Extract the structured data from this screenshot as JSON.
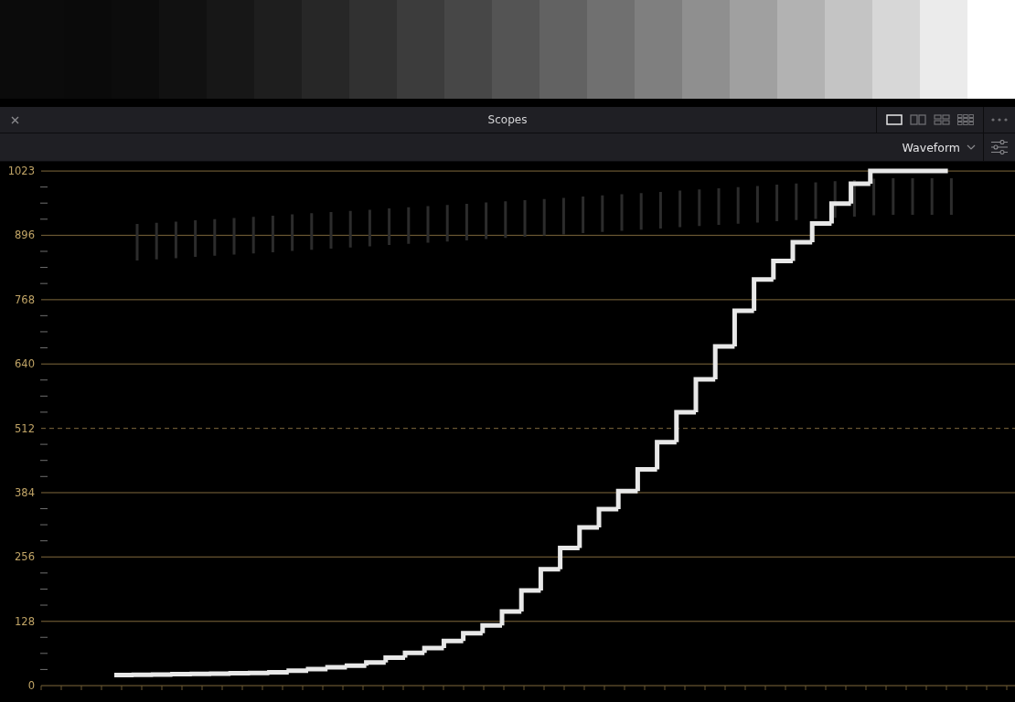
{
  "panel": {
    "title": "Scopes",
    "layouts": [
      {
        "kind": "single",
        "selected": true
      },
      {
        "kind": "double",
        "selected": false
      },
      {
        "kind": "quad",
        "selected": false
      },
      {
        "kind": "six",
        "selected": false
      }
    ],
    "scope_type": "Waveform"
  },
  "axis": [
    {
      "label": "1023",
      "dashed": false
    },
    {
      "label": "896",
      "dashed": false
    },
    {
      "label": "768",
      "dashed": false
    },
    {
      "label": "640",
      "dashed": false
    },
    {
      "label": "512",
      "dashed": true
    },
    {
      "label": "384",
      "dashed": false
    },
    {
      "label": "256",
      "dashed": false
    },
    {
      "label": "128",
      "dashed": false
    },
    {
      "label": "0",
      "dashed": false
    }
  ]
}
